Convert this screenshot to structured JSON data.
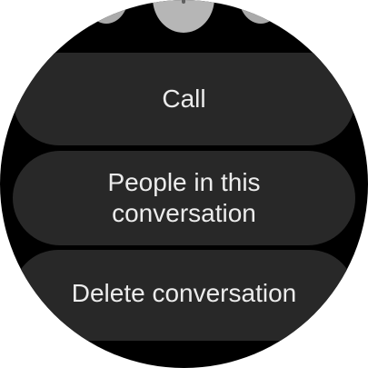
{
  "menu": {
    "items": [
      {
        "label": "Call"
      },
      {
        "label": "People in this conversation"
      },
      {
        "label": "Delete conversation"
      }
    ]
  },
  "colors": {
    "background": "#000000",
    "chip": "#282828",
    "text": "#ececec"
  }
}
